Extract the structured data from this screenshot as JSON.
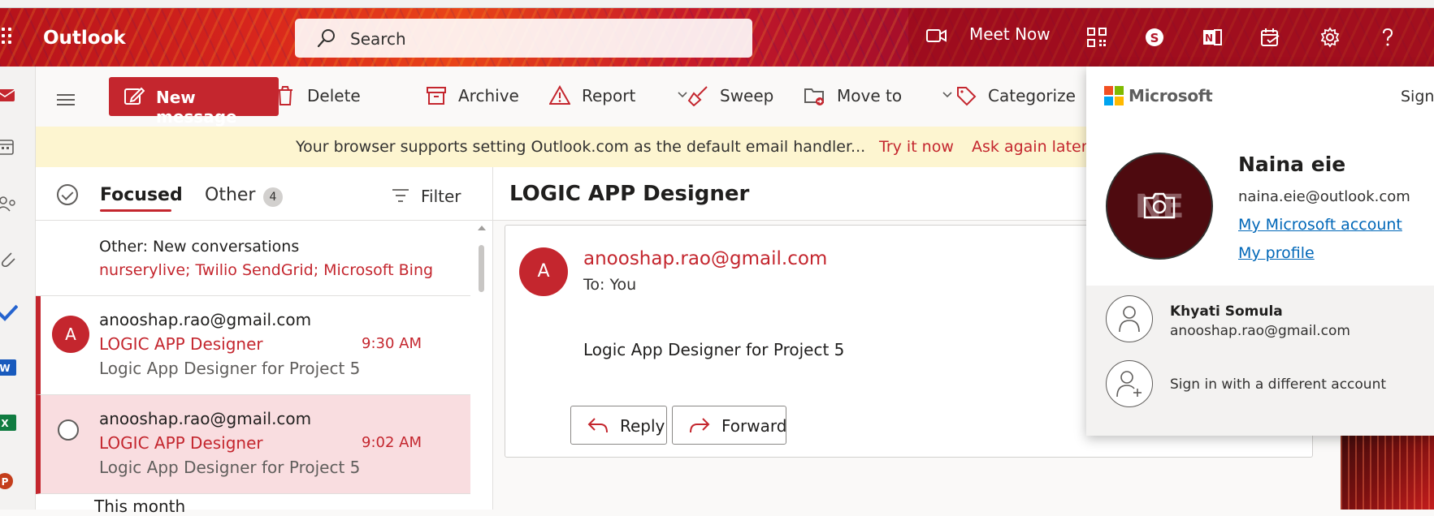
{
  "header": {
    "app_name": "Outlook",
    "search_placeholder": "Search",
    "meet_now_label": "Meet Now",
    "icons": [
      "app-launcher-icon",
      "video-camera-icon",
      "qr-code-icon",
      "skype-icon",
      "onenote-icon",
      "my-day-icon",
      "settings-gear-icon",
      "help-icon"
    ]
  },
  "left_rail": {
    "icons": [
      "mail-icon",
      "calendar-icon",
      "people-icon",
      "attachment-icon",
      "todo-icon",
      "word-icon",
      "excel-icon",
      "powerpoint-icon"
    ]
  },
  "command_bar": {
    "new_message_label": "New message",
    "delete_label": "Delete",
    "archive_label": "Archive",
    "report_label": "Report",
    "sweep_label": "Sweep",
    "move_to_label": "Move to",
    "categorize_label": "Categorize"
  },
  "notice": {
    "message": "Your browser supports setting Outlook.com as the default email handler...",
    "try_it_now": "Try it now",
    "ask_again_later": "Ask again later"
  },
  "message_list": {
    "tab_focused": "Focused",
    "tab_other": "Other",
    "other_count": "4",
    "filter_label": "Filter",
    "other_summary": {
      "title": "Other: New conversations",
      "senders": "nurserylive; Twilio SendGrid; Microsoft Bing"
    },
    "items": [
      {
        "avatar_initial": "A",
        "from": "anooshap.rao@gmail.com",
        "subject": "LOGIC APP Designer",
        "preview": "Logic App Designer for Project 5",
        "time": "9:30 AM"
      },
      {
        "avatar_initial": "",
        "from": "anooshap.rao@gmail.com",
        "subject": "LOGIC APP Designer",
        "preview": "Logic App Designer for Project 5",
        "time": "9:02 AM"
      }
    ],
    "section_below": "This month"
  },
  "reading_pane": {
    "subject": "LOGIC APP Designer",
    "sender_initial": "A",
    "sender": "anooshap.rao@gmail.com",
    "to_line": "To:  You",
    "body": "Logic App Designer for Project 5",
    "reply_label": "Reply",
    "forward_label": "Forward"
  },
  "account_popup": {
    "brand": "Microsoft",
    "sign_out_label": "Sign",
    "user_initials": "NE",
    "user_name": "Naina eie",
    "user_email": "naina.eie@outlook.com",
    "link_account": "My Microsoft account",
    "link_profile": "My profile",
    "other_account_name": "Khyati Somula",
    "other_account_email": "anooshap.rao@gmail.com",
    "sign_in_different": "Sign in with a different account"
  },
  "colors": {
    "accent": "#c4262e",
    "link": "#0067b8",
    "notice_bg": "#fdf5d0",
    "selected_row_bg": "#f9dde0"
  }
}
